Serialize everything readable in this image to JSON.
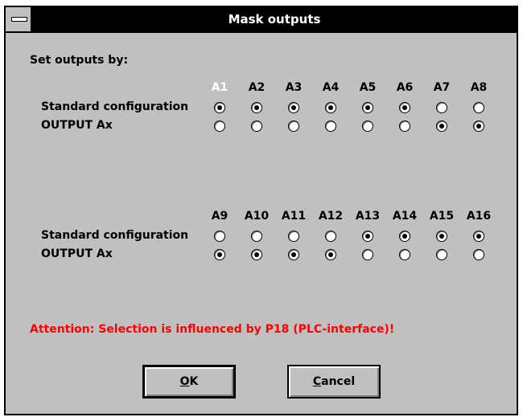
{
  "window": {
    "title": "Mask outputs"
  },
  "intro_label": "Set outputs by:",
  "group1": {
    "columns": [
      "A1",
      "A2",
      "A3",
      "A4",
      "A5",
      "A6",
      "A7",
      "A8"
    ],
    "highlighted_column": "A1",
    "row_std_label": "Standard configuration",
    "row_out_label": "OUTPUT Ax",
    "standard_selected": [
      true,
      true,
      true,
      true,
      true,
      true,
      false,
      false
    ],
    "output_selected": [
      false,
      false,
      false,
      false,
      false,
      false,
      true,
      true
    ]
  },
  "group2": {
    "columns": [
      "A9",
      "A10",
      "A11",
      "A12",
      "A13",
      "A14",
      "A15",
      "A16"
    ],
    "row_std_label": "Standard configuration",
    "row_out_label": "OUTPUT Ax",
    "standard_selected": [
      false,
      false,
      false,
      false,
      true,
      true,
      true,
      true
    ],
    "output_selected": [
      true,
      true,
      true,
      true,
      false,
      false,
      false,
      false
    ]
  },
  "attention": "Attention:  Selection is influenced by P18 (PLC-interface)!",
  "buttons": {
    "ok": {
      "mnemonic": "O",
      "rest": "K"
    },
    "cancel": {
      "mnemonic": "C",
      "rest": "ancel"
    }
  },
  "colors": {
    "titlebar": "#000000",
    "face": "#c0c0c0",
    "warning": "#ff0000",
    "selected_header": "#ffffff"
  }
}
